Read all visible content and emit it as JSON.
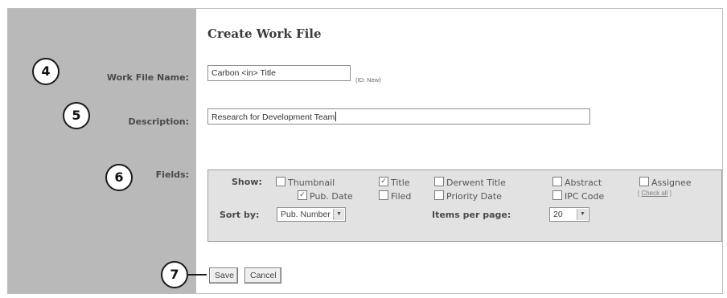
{
  "form": {
    "title": "Create Work File",
    "labels": {
      "work_file_name": "Work File Name:",
      "description": "Description:",
      "fields": "Fields:"
    },
    "work_file_name_value": "Carbon <in> Title",
    "id_note": "(ID: New)",
    "description_value": "Research for Development Team"
  },
  "fields_panel": {
    "show_label": "Show:",
    "options": [
      {
        "label": "Thumbnail",
        "checked": false
      },
      {
        "label": "Title",
        "checked": true
      },
      {
        "label": "Derwent Title",
        "checked": false
      },
      {
        "label": "Abstract",
        "checked": false
      },
      {
        "label": "Assignee",
        "checked": false
      },
      {
        "label": "Pub. Date",
        "checked": true
      },
      {
        "label": "Filed",
        "checked": false
      },
      {
        "label": "Priority Date",
        "checked": false
      },
      {
        "label": "IPC Code",
        "checked": false
      }
    ],
    "check_all_link": "Check all",
    "sort_by_label": "Sort by:",
    "sort_by_value": "Pub. Number",
    "items_per_page_label": "Items per page:",
    "items_per_page_value": "20"
  },
  "buttons": {
    "save": "Save",
    "cancel": "Cancel"
  },
  "callouts": [
    "4",
    "5",
    "6",
    "7"
  ],
  "colors": {
    "sidebar": "#b9b9b9",
    "fields_panel_bg": "#e2e2e2",
    "callout_border": "#1a1a1a"
  }
}
